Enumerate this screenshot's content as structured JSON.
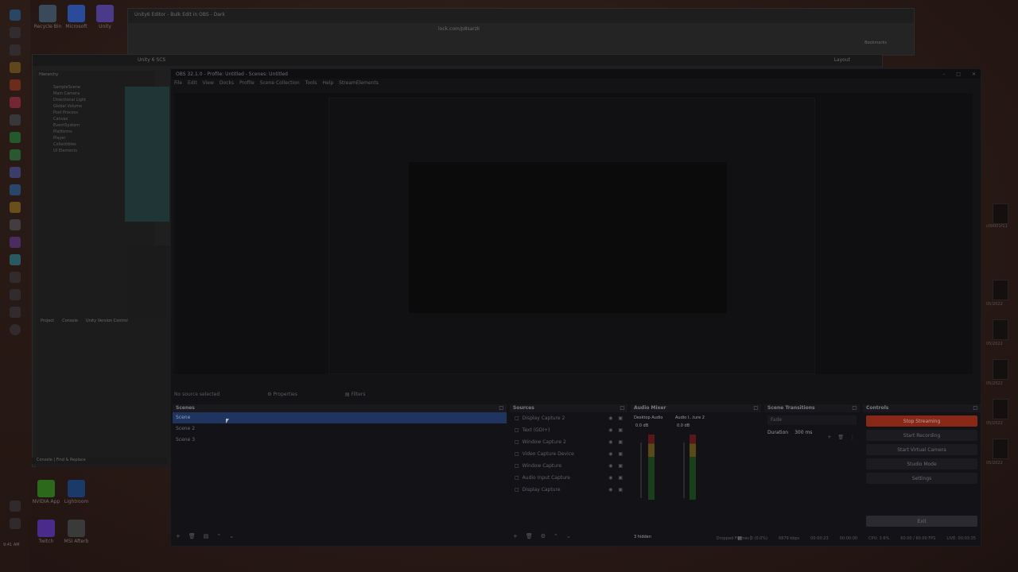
{
  "browser": {
    "tab_title": "Unity6 Editor - Bulk Edit in OBS - Dark",
    "address": "lock.com/p8sarzk",
    "bookmarks": "Bookmarks"
  },
  "unity": {
    "menubar_title": "Unity 6 SCS",
    "layout_label": "Layout",
    "hierarchy_label": "Hierarchy",
    "hierarchy_items": [
      "SampleScene",
      "Main Camera",
      "Directional Light",
      "Global Volume",
      "Post Process",
      "Canvas",
      "EventSystem",
      "Platforms",
      "Player",
      "Collectibles",
      "UI Elements"
    ],
    "project_tab": "Project",
    "console_tab": "Console",
    "viewer_tab": "Unity Version Control",
    "footer": "Console | Find & Replace"
  },
  "desktop": {
    "icons_top": [
      {
        "label": "Recycle Bin"
      },
      {
        "label": "Microsoft"
      },
      {
        "label": "Unity"
      }
    ],
    "icons_bottom": [
      {
        "label": "NVIDIA App"
      },
      {
        "label": "Lightroom"
      },
      {
        "label": "Twitch"
      },
      {
        "label": "MSI Afterb"
      }
    ],
    "right_labels": [
      "c00001f11",
      "05/2022",
      "05/2022",
      "05/2022",
      "05/2022",
      "05/2022"
    ],
    "clock": "9:41 AM"
  },
  "obs": {
    "title": "OBS 32.1.0 - Profile: Untitled - Scenes: Untitled",
    "menu": [
      "File",
      "Edit",
      "View",
      "Docks",
      "Profile",
      "Scene Collection",
      "Tools",
      "Help",
      "StreamElements"
    ],
    "context": {
      "no_source": "No source selected",
      "properties": "Properties",
      "filters": "Filters"
    },
    "scenes": {
      "title": "Scenes",
      "items": [
        "Scene",
        "Scene 2",
        "Scene 3"
      ],
      "active_index": 0
    },
    "sources": {
      "title": "Sources",
      "items": [
        "Display Capture 2",
        "Text (GDI+)",
        "Window Capture 2",
        "Video Capture Device",
        "Window Capture",
        "Audio Input Capture",
        "Display Capture"
      ]
    },
    "mixer": {
      "title": "Audio Mixer",
      "channels": [
        {
          "name": "Desktop Audio",
          "db": "0.0 dB"
        },
        {
          "name": "Audio I...ture 2",
          "db": "0.0 dB"
        }
      ],
      "hidden": "3 hidden"
    },
    "transitions": {
      "title": "Scene Transitions",
      "type": "Fade",
      "duration_label": "Duration",
      "duration_value": "300 ms"
    },
    "controls": {
      "title": "Controls",
      "buttons": [
        "Stop Streaming",
        "Start Recording",
        "Start Virtual Camera",
        "Studio Mode",
        "Settings"
      ],
      "exit": "Exit"
    },
    "status": {
      "dropped": "Dropped Frames 0 (0.0%)",
      "bitrate": "6879 kbps",
      "stream_time": "00:00:23",
      "rec_time": "00:00:00",
      "cpu": "CPU: 3.6%",
      "fps": "60.00 / 60.00 FPS",
      "live": "LIVE: 00:03:35"
    }
  }
}
